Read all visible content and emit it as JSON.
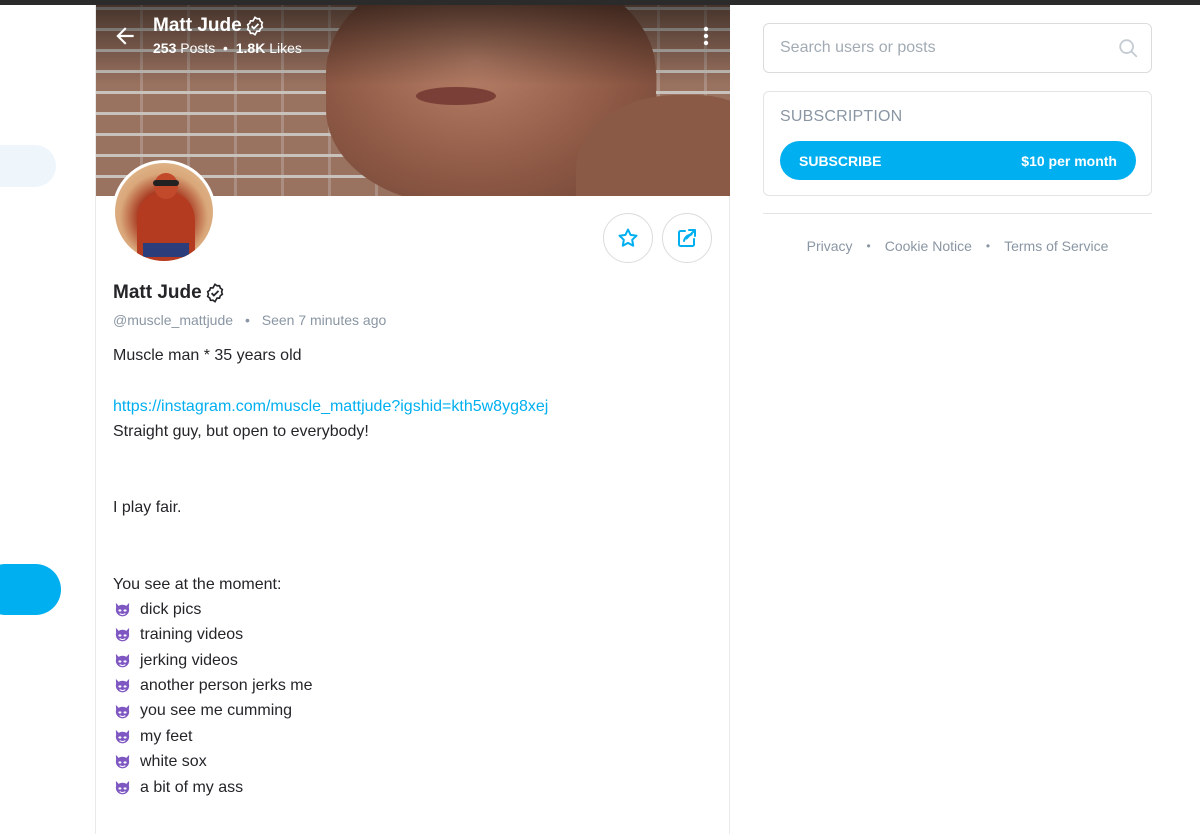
{
  "header": {
    "name": "Matt Jude",
    "posts_count": "253",
    "posts_label": "Posts",
    "likes_count": "1.8K",
    "likes_label": "Likes"
  },
  "profile": {
    "name": "Matt Jude",
    "handle": "@muscle_mattjude",
    "last_seen": "Seen 7 minutes ago",
    "bio_lines": [
      "Muscle man * 35 years old",
      "",
      "https://instagram.com/muscle_mattjude?igshid=kth5w8yg8xej",
      "Straight guy, but open to everybody!",
      "",
      "",
      "I play fair.",
      "",
      "",
      "You see at the moment:"
    ],
    "content_items": [
      "dick pics",
      "training videos",
      "jerking videos",
      "another person jerks me",
      "you see me cumming",
      "my feet",
      "white sox",
      "a bit of my ass"
    ]
  },
  "search": {
    "placeholder": "Search users or posts"
  },
  "subscription": {
    "title": "SUBSCRIPTION",
    "button_label": "SUBSCRIBE",
    "price": "$10 per month"
  },
  "footer": {
    "links": [
      "Privacy",
      "Cookie Notice",
      "Terms of Service"
    ]
  },
  "colors": {
    "accent": "#00aff0",
    "muted": "#8a96a3",
    "text": "#242529",
    "devil_icon": "#7e57c2"
  },
  "icons": {
    "back": "arrow-left-icon",
    "more": "vertical-dots-icon",
    "verified": "verified-badge-icon",
    "favorite": "star-icon",
    "share": "share-icon",
    "search": "search-icon",
    "list_bullet": "smiling-devil-icon"
  }
}
